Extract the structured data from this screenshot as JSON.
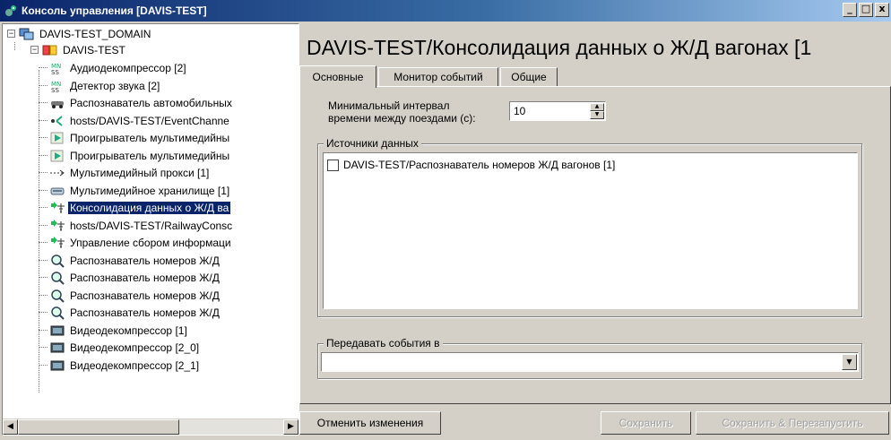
{
  "window": {
    "title": "Консоль управления [DAVIS-TEST]",
    "controls": {
      "minimize": "_",
      "maximize": "□",
      "close": "x"
    }
  },
  "tree": {
    "domain": "DAVIS-TEST_DOMAIN",
    "server": "DAVIS-TEST",
    "items": [
      {
        "label": "Аудиодекомпрессор [2]",
        "icon": "audio-decompressor-icon"
      },
      {
        "label": "Детектор звука [2]",
        "icon": "sound-detector-icon"
      },
      {
        "label": "Распознаватель автомобильных",
        "icon": "car-recognizer-icon"
      },
      {
        "label": "hosts/DAVIS-TEST/EventChanne",
        "icon": "event-channel-icon"
      },
      {
        "label": "Проигрыватель мультимедийны",
        "icon": "media-player-icon"
      },
      {
        "label": "Проигрыватель мультимедийны",
        "icon": "media-player-icon"
      },
      {
        "label": "Мультимедийный прокси [1]",
        "icon": "media-proxy-icon"
      },
      {
        "label": "Мультимедийное хранилище [1]",
        "icon": "media-storage-icon"
      },
      {
        "label": "Консолидация данных о Ж/Д ва",
        "icon": "consolidation-icon",
        "selected": true
      },
      {
        "label": "hosts/DAVIS-TEST/RailwayConsc",
        "icon": "consolidation-icon"
      },
      {
        "label": "Управление сбором информаци",
        "icon": "consolidation-icon"
      },
      {
        "label": "Распознаватель номеров Ж/Д",
        "icon": "magnifier-icon"
      },
      {
        "label": "Распознаватель номеров Ж/Д",
        "icon": "magnifier-icon"
      },
      {
        "label": "Распознаватель номеров Ж/Д",
        "icon": "magnifier-icon"
      },
      {
        "label": "Распознаватель номеров Ж/Д",
        "icon": "magnifier-icon"
      },
      {
        "label": "Видеодекомпрессор [1]",
        "icon": "video-decompressor-icon"
      },
      {
        "label": "Видеодекомпрессор [2_0]",
        "icon": "video-decompressor-icon"
      },
      {
        "label": "Видеодекомпрессор [2_1]",
        "icon": "video-decompressor-icon"
      }
    ]
  },
  "main": {
    "heading": "DAVIS-TEST/Консолидация данных о Ж/Д вагонах [1",
    "tabs": [
      {
        "label": "Основные",
        "active": true
      },
      {
        "label": "Монитор событий",
        "active": false
      },
      {
        "label": "Общие",
        "active": false
      }
    ],
    "interval": {
      "label_line1": "Минимальный интервал",
      "label_line2": "времени между поездами (с):",
      "value": "10"
    },
    "sources": {
      "legend": "Источники данных",
      "items": [
        {
          "label": "DAVIS-TEST/Распознаватель номеров Ж/Д вагонов [1]",
          "checked": false
        }
      ]
    },
    "forward": {
      "legend": "Передавать события в",
      "value": ""
    },
    "buttons": {
      "cancel": "Отменить изменения",
      "save": "Сохранить",
      "save_restart": "Сохранить & Перезапустить"
    }
  },
  "colors": {
    "selection": "#0a246a",
    "face": "#d4d0c8",
    "title_gradient_start": "#0a246a",
    "title_gradient_end": "#a6caf0"
  }
}
